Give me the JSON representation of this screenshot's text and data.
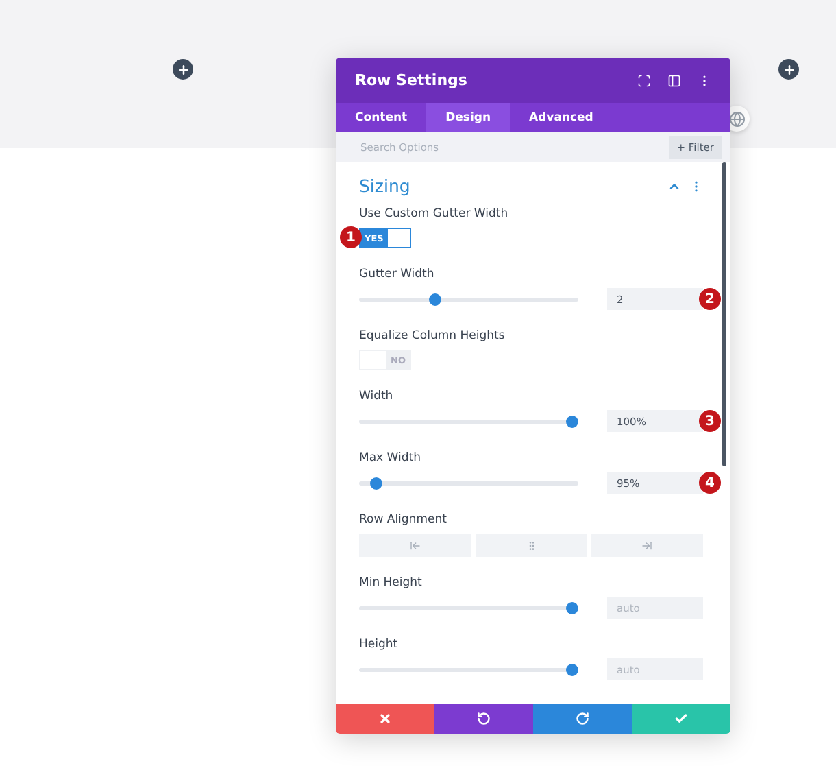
{
  "modal": {
    "title": "Row Settings",
    "tabs": [
      {
        "label": "Content",
        "selected": false
      },
      {
        "label": "Design",
        "selected": true
      },
      {
        "label": "Advanced",
        "selected": false
      }
    ],
    "search": {
      "placeholder": "Search Options"
    },
    "filter_button": "+ Filter",
    "section": {
      "title": "Sizing",
      "expanded": true
    },
    "fields": [
      {
        "kind": "toggle",
        "label": "Use Custom Gutter Width",
        "on": true,
        "text": "YES",
        "marker": "1"
      },
      {
        "kind": "slider",
        "label": "Gutter Width",
        "level": 0.34,
        "value": "2",
        "marker": "2"
      },
      {
        "kind": "toggle",
        "label": "Equalize Column Heights",
        "on": false,
        "text": "NO"
      },
      {
        "kind": "slider",
        "label": "Width",
        "level": 1,
        "value": "100%",
        "marker": "3"
      },
      {
        "kind": "slider",
        "label": "Max Width",
        "level": 0.05,
        "value": "95%",
        "marker": "4"
      },
      {
        "kind": "alignment",
        "label": "Row Alignment"
      },
      {
        "kind": "slider",
        "label": "Min Height",
        "level": 1,
        "placeholder": "auto"
      },
      {
        "kind": "slider",
        "label": "Height",
        "level": 1,
        "placeholder": "auto"
      }
    ]
  }
}
